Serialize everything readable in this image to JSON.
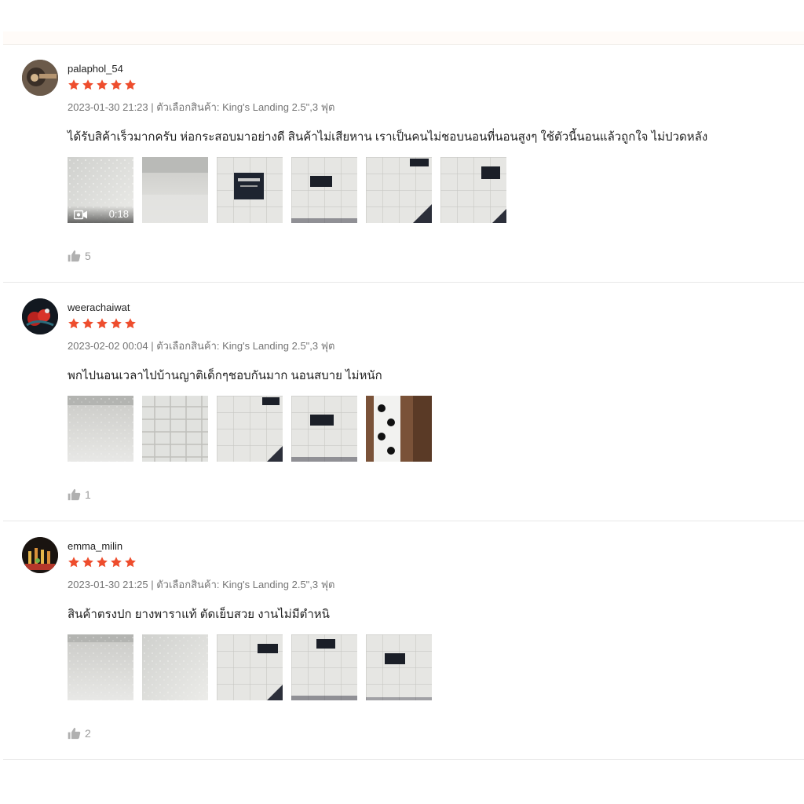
{
  "colors": {
    "star": "#ee4d2d",
    "meta": "#757575",
    "like": "#9e9e9e"
  },
  "reviews": [
    {
      "username": "palaphol_54",
      "rating": 5,
      "meta": "2023-01-30 21:23 | ตัวเลือกสินค้า: King's Landing 2.5\",3 ฟุต",
      "comment": "ได้รับสิค้าเร็วมากครับ ห่อกระสอบมาอย่างดี สินค้าไม่เสียหาน เราเป็นคนไม่ชอบนอนที่นอนสูงๆ ใช้ตัวนี้นอนแล้วถูกใจ ไม่ปวดหลัง",
      "video_duration": "0:18",
      "likes": "5"
    },
    {
      "username": "weerachaiwat",
      "rating": 5,
      "meta": "2023-02-02 00:04 | ตัวเลือกสินค้า: King's Landing 2.5\",3 ฟุต",
      "comment": "พกไปนอนเวลาไปบ้านญาติเด็กๆชอบกันมาก นอนสบาย ไม่หนัก",
      "likes": "1"
    },
    {
      "username": "emma_milin",
      "rating": 5,
      "meta": "2023-01-30 21:25 | ตัวเลือกสินค้า: King's Landing 2.5\",3 ฟุต",
      "comment": "สินค้าตรงปก ยางพาราแท้ ตัดเย็บสวย งานไม่มีตำหนิ",
      "likes": "2"
    }
  ]
}
